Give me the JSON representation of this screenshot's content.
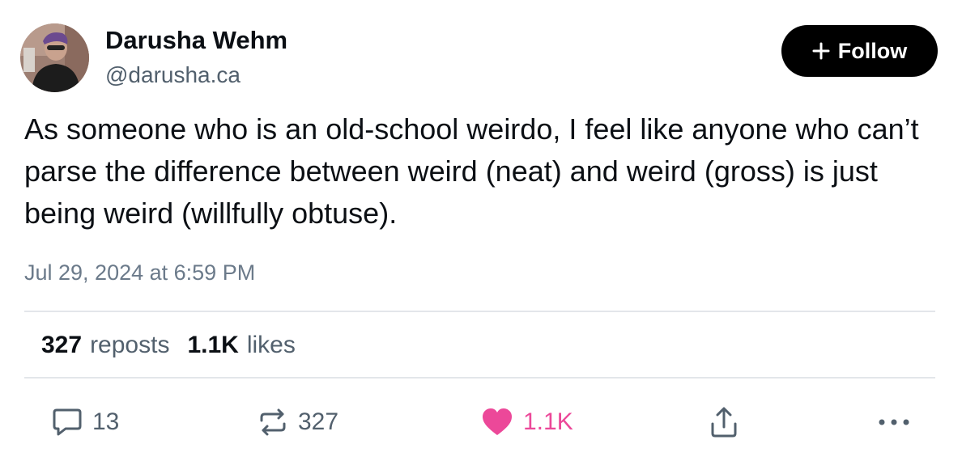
{
  "author": {
    "name": "Darusha Wehm",
    "handle": "@darusha.ca"
  },
  "follow_button": {
    "label": "Follow",
    "icon": "plus-icon"
  },
  "post": {
    "text": "As someone who is an old-school weirdo, I feel like anyone who can’t parse the difference between weird (neat) and weird (gross) is just being weird (willfully obtuse).",
    "timestamp": "Jul 29, 2024 at 6:59 PM"
  },
  "stats": {
    "reposts_count": "327",
    "reposts_label": "reposts",
    "likes_count": "1.1K",
    "likes_label": "likes"
  },
  "actions": {
    "reply": {
      "icon": "comment-icon",
      "count": "13"
    },
    "repost": {
      "icon": "repost-icon",
      "count": "327"
    },
    "like": {
      "icon": "heart-icon",
      "count": "1.1K",
      "color": "#ec4899",
      "active": true
    },
    "share": {
      "icon": "share-icon"
    },
    "more": {
      "icon": "more-horizontal-icon"
    }
  },
  "colors": {
    "primary_text": "#0b0f14",
    "secondary_text": "#52606d",
    "like_active": "#ec4899",
    "follow_bg": "#000000"
  }
}
